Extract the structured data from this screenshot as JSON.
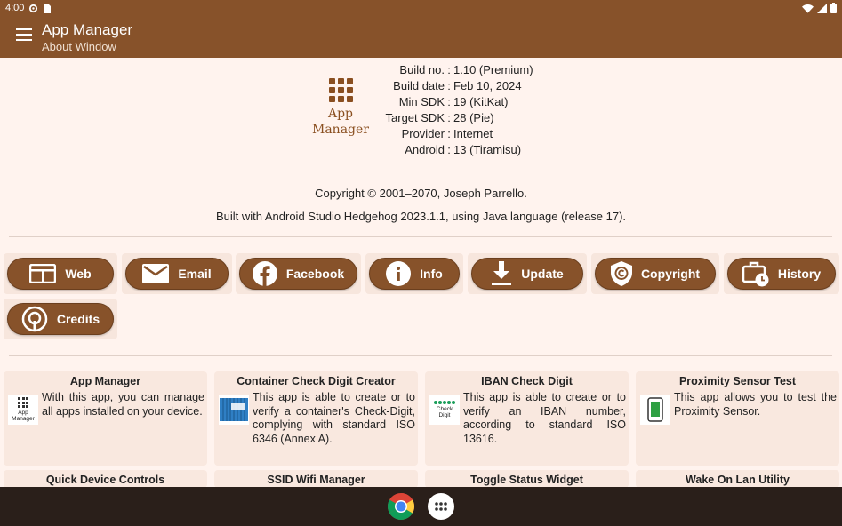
{
  "status": {
    "time": "4:00"
  },
  "appbar": {
    "title": "App Manager",
    "subtitle": "About Window"
  },
  "logo": {
    "line1": "App",
    "line2": "Manager"
  },
  "build": [
    {
      "label": "Build no.",
      "value": "1.10 (Premium)"
    },
    {
      "label": "Build date",
      "value": "Feb 10, 2024"
    },
    {
      "label": "Min SDK",
      "value": "19 (KitKat)"
    },
    {
      "label": "Target SDK",
      "value": "28 (Pie)"
    },
    {
      "label": "Provider",
      "value": "Internet"
    },
    {
      "label": "Android",
      "value": "13 (Tiramisu)"
    }
  ],
  "separator": ":",
  "copyright": "Copyright © 2001–2070, Joseph Parrello.",
  "built_with": "Built with Android Studio Hedgehog 2023.1.1, using Java language (release 17).",
  "buttons": {
    "web": "Web",
    "email": "Email",
    "facebook": "Facebook",
    "info": "Info",
    "update": "Update",
    "copyright": "Copyright",
    "history": "History",
    "credits": "Credits"
  },
  "apps": [
    {
      "title": "App Manager",
      "desc": "With this app, you can manage all apps installed on your device.",
      "icon_text": "App Manager"
    },
    {
      "title": "Container Check Digit Creator",
      "desc": "This app is able to create or to verify a container's Check-Digit, complying with standard ISO 6346 (Annex A)."
    },
    {
      "title": "IBAN Check Digit",
      "desc": "This app is able to create or to verify an IBAN number, according to standard ISO 13616.",
      "icon_text": "Check Digit"
    },
    {
      "title": "Proximity Sensor Test",
      "desc": "This app allows you to test the Proximity Sensor."
    },
    {
      "title": "Quick Device Controls"
    },
    {
      "title": "SSID Wifi Manager"
    },
    {
      "title": "Toggle Status Widget"
    },
    {
      "title": "Wake On Lan Utility"
    }
  ],
  "colors": {
    "primary": "#87522a",
    "background": "#fff3ee",
    "card": "#f9e8df",
    "navbar": "#2a1f1a"
  }
}
